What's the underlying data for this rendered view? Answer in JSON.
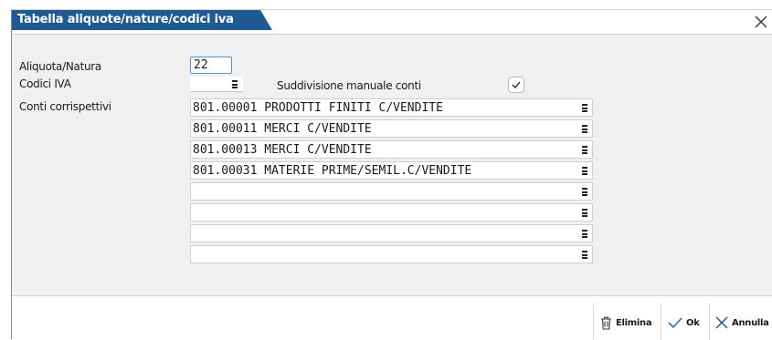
{
  "window": {
    "title": "Tabella aliquote/nature/codici iva"
  },
  "form": {
    "aliquota_label": "Aliquota/Natura",
    "aliquota_value": "22",
    "codici_label": "Codici IVA",
    "codici_value": "",
    "suddivisione_label": "Suddivisione manuale conti",
    "suddivisione_checked": true,
    "conti_label": "Conti corrispettivi",
    "conti": [
      "801.00001 PRODOTTI FINITI C/VENDITE",
      "801.00011 MERCI C/VENDITE",
      "801.00013 MERCI C/VENDITE",
      "801.00031 MATERIE PRIME/SEMIL.C/VENDITE",
      "",
      "",
      "",
      ""
    ]
  },
  "footer": {
    "elimina": "Elimina",
    "ok": "Ok",
    "annulla": "Annulla"
  },
  "icons": [
    "close-icon",
    "menu-icon",
    "check-icon",
    "trash-icon",
    "ok-check-icon",
    "cancel-x-icon"
  ],
  "colors": {
    "title_bar": "#1f5a93",
    "input_focus_border": "#5b8fd0",
    "panel_bg": "#f0f0f0",
    "ok_blue": "#2b6cc4"
  }
}
